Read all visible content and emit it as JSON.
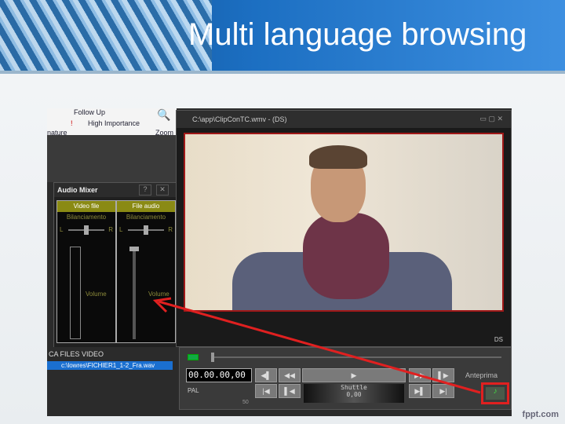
{
  "slide": {
    "title": "Multi language browsing",
    "footer": "fppt.com"
  },
  "ribbon": {
    "follow_up": "Follow Up",
    "high_importance": "High Importance",
    "zoom": "Zoom",
    "signature": "nature"
  },
  "mixer": {
    "title": "Audio Mixer",
    "help": "?",
    "close": "✕",
    "channels": [
      {
        "name": "Video file",
        "balance": "Bilanciamento",
        "left": "L",
        "right": "R",
        "volume": "Volume"
      },
      {
        "name": "File audio",
        "balance": "Bilanciamento",
        "left": "L",
        "right": "R",
        "volume": "Volume"
      }
    ]
  },
  "video_window": {
    "title": "C:\\app\\ClipConTC.wmv - (DS)",
    "mode": "DS"
  },
  "files": {
    "header": "CA  FILES VIDEO",
    "selected": "c:\\lowres\\FICHIER1_1-2_Fra.wav"
  },
  "controls": {
    "timecode": "00.00.00,00",
    "format": "PAL",
    "fps": "50",
    "shuttle_label": "Shuttle",
    "shuttle_value": "0,00",
    "preview_label": "Anteprima"
  },
  "colors": {
    "highlight": "#e02020",
    "selection": "#1a6fd0"
  }
}
